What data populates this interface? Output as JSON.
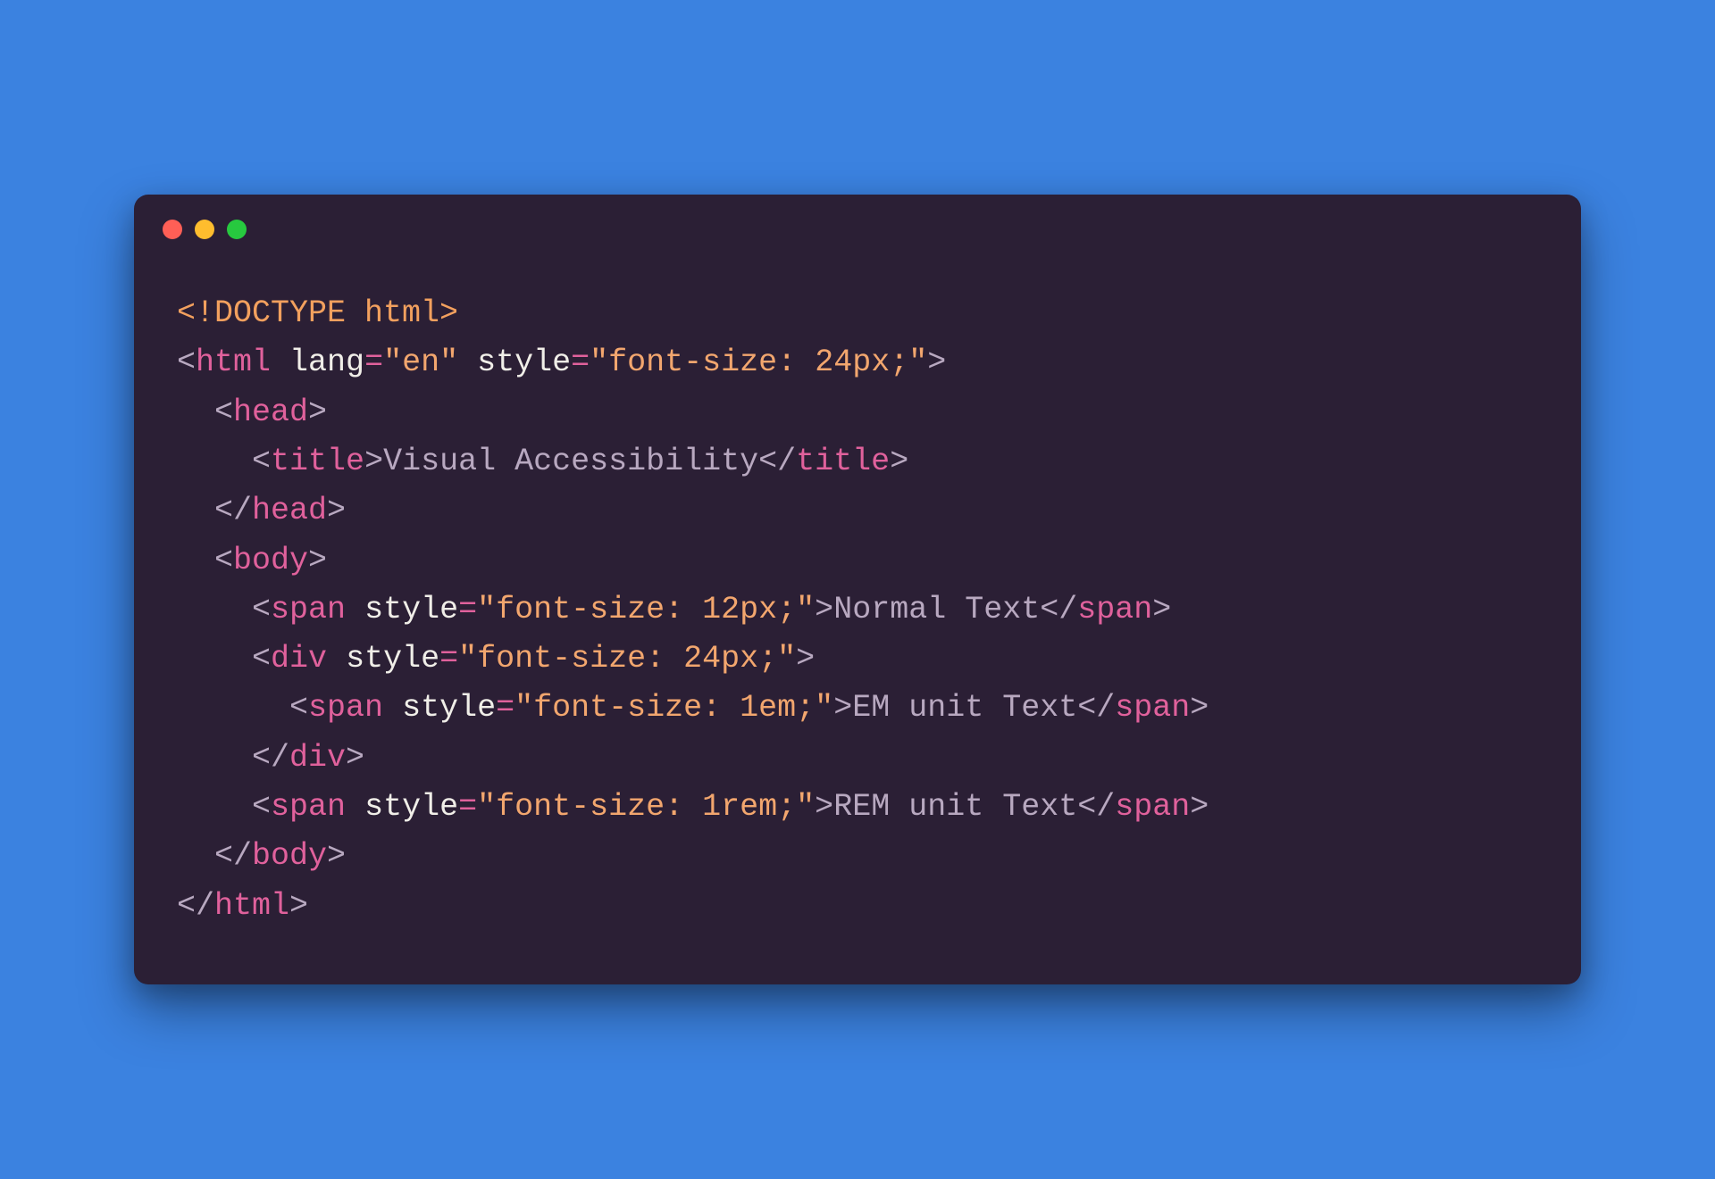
{
  "window": {
    "traffic_lights": [
      "red",
      "yellow",
      "green"
    ]
  },
  "code": {
    "line1": {
      "doctype": "<!DOCTYPE html>"
    },
    "line2": {
      "open": "<",
      "tag": "html",
      "attr1": "lang",
      "eq": "=",
      "val1": "\"en\"",
      "attr2": "style",
      "val2": "\"font-size: 24px;\"",
      "close": ">"
    },
    "line3": {
      "open": "<",
      "tag": "head",
      "close": ">"
    },
    "line4": {
      "open": "<",
      "tag": "title",
      "close": ">",
      "text": "Visual Accessibility",
      "open2": "</",
      "tag2": "title",
      "close2": ">"
    },
    "line5": {
      "open": "</",
      "tag": "head",
      "close": ">"
    },
    "line6": {
      "open": "<",
      "tag": "body",
      "close": ">"
    },
    "line7": {
      "open": "<",
      "tag": "span",
      "attr": "style",
      "eq": "=",
      "val": "\"font-size: 12px;\"",
      "close": ">",
      "text": "Normal Text",
      "open2": "</",
      "tag2": "span",
      "close2": ">"
    },
    "line8": {
      "open": "<",
      "tag": "div",
      "attr": "style",
      "eq": "=",
      "val": "\"font-size: 24px;\"",
      "close": ">"
    },
    "line9": {
      "open": "<",
      "tag": "span",
      "attr": "style",
      "eq": "=",
      "val": "\"font-size: 1em;\"",
      "close": ">",
      "text": "EM unit Text",
      "open2": "</",
      "tag2": "span",
      "close2": ">"
    },
    "line10": {
      "open": "</",
      "tag": "div",
      "close": ">"
    },
    "line11": {
      "open": "<",
      "tag": "span",
      "attr": "style",
      "eq": "=",
      "val": "\"font-size: 1rem;\"",
      "close": ">",
      "text": "REM unit Text",
      "open2": "</",
      "tag2": "span",
      "close2": ">"
    },
    "line12": {
      "open": "</",
      "tag": "body",
      "close": ">"
    },
    "line13": {
      "open": "</",
      "tag": "html",
      "close": ">"
    }
  }
}
